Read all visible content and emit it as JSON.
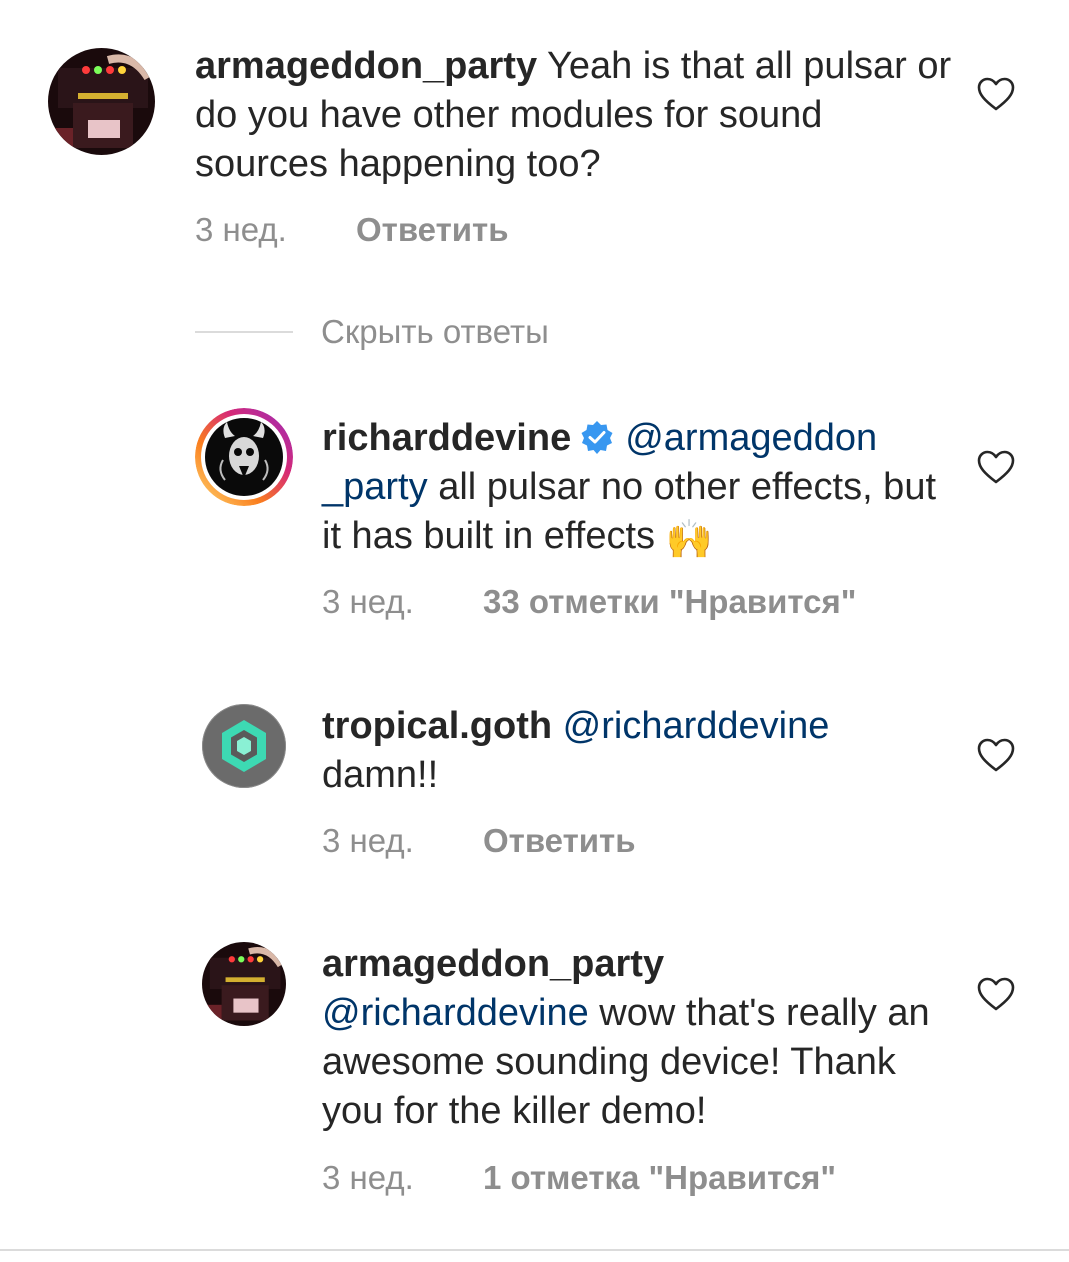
{
  "comments": [
    {
      "username": "armageddon_party",
      "text": "Yeah is that all pulsar or do you have other modules for sound sources happening too?",
      "time": "3 нед.",
      "action": "Ответить"
    },
    {
      "username": "richarddevine",
      "verified": true,
      "mention": "@armageddon _party",
      "text": "all pulsar no other effects, but it has built in effects",
      "emoji": "🙌",
      "time": "3 нед.",
      "action": "33 отметки \"Нравится\""
    },
    {
      "username": "tropical.goth",
      "mention": "@richarddevine",
      "text": "damn!!",
      "time": "3 нед.",
      "action": "Ответить"
    },
    {
      "username": "armageddon_party",
      "mention": "@richarddevine",
      "text": "wow that's really an awesome sounding device! Thank you for the killer demo!",
      "time": "3 нед.",
      "action": "1 отметка \"Нравится\""
    }
  ],
  "hide_replies": {
    "label": "Скрыть ответы"
  },
  "icons": {
    "like": "heart-outline-icon",
    "verified": "verified-badge-icon"
  },
  "colors": {
    "text": "#262626",
    "secondary": "#8e8e8e",
    "mention": "#003569",
    "verified": "#3897f0",
    "divider": "#dbdbdb"
  }
}
